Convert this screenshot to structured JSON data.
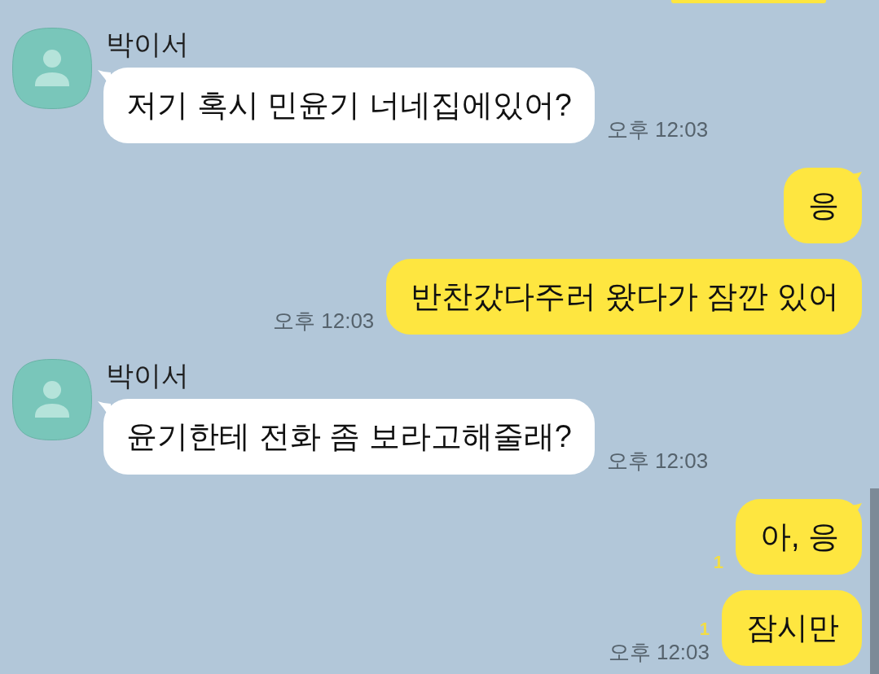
{
  "messages": [
    {
      "kind": "partial"
    },
    {
      "kind": "received",
      "sender": "박이서",
      "text": "저기 혹시 민윤기 너네집에있어?",
      "time": "오후 12:03",
      "tail": true
    },
    {
      "kind": "sent",
      "text": "응",
      "tail": true
    },
    {
      "kind": "sent",
      "text": "반찬갔다주러 왔다가 잠깐 있어",
      "time": "오후 12:03",
      "tail": false
    },
    {
      "kind": "received",
      "sender": "박이서",
      "text": "윤기한테 전화 좀 보라고해줄래?",
      "time": "오후 12:03",
      "tail": true
    },
    {
      "kind": "sent",
      "text": "아, 응",
      "unread": "1",
      "tail": true
    },
    {
      "kind": "sent",
      "text": "잠시만",
      "unread": "1",
      "time": "오후 12:03",
      "tail": false
    }
  ]
}
